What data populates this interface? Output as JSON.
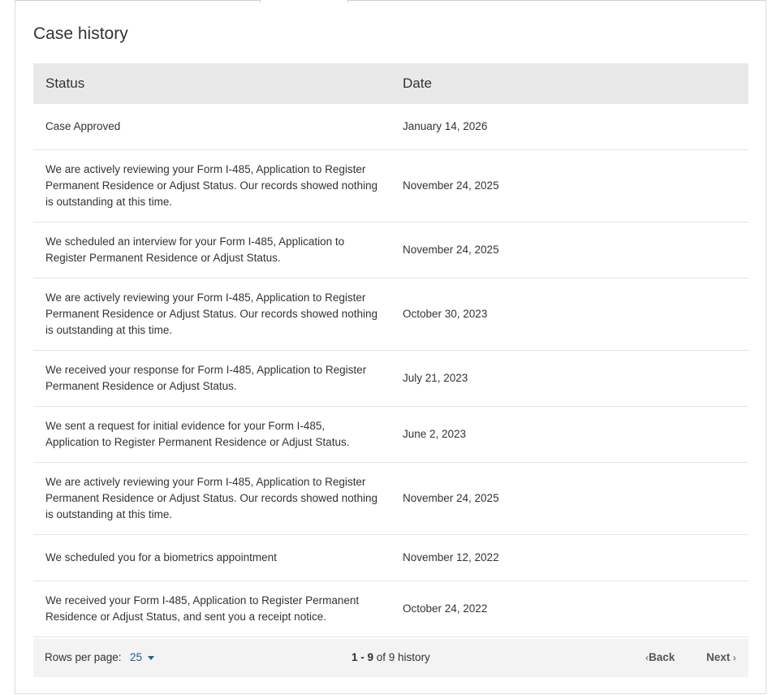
{
  "title": "Case history",
  "table": {
    "headers": {
      "status": "Status",
      "date": "Date"
    },
    "rows": [
      {
        "status": "Case Approved",
        "date": "January 14, 2026"
      },
      {
        "status": "We are actively reviewing your Form I-485, Application to Register Permanent Residence or Adjust Status. Our records showed nothing is outstanding at this time.",
        "date": "November 24, 2025"
      },
      {
        "status": "We scheduled an interview for your Form I-485, Application to Register Permanent Residence or Adjust Status.",
        "date": "November 24, 2025"
      },
      {
        "status": "We are actively reviewing your Form I-485, Application to Register Permanent Residence or Adjust Status. Our records showed nothing is outstanding at this time.",
        "date": "October 30, 2023"
      },
      {
        "status": "We received your response for Form I-485, Application to Register Permanent Residence or Adjust Status.",
        "date": "July 21, 2023"
      },
      {
        "status": "We sent a request for initial evidence for your Form I-485, Application to Register Permanent Residence or Adjust Status.",
        "date": "June 2, 2023"
      },
      {
        "status": "We are actively reviewing your Form I-485, Application to Register Permanent Residence or Adjust Status. Our records showed nothing is outstanding at this time.",
        "date": "November 24, 2025"
      },
      {
        "status": "We scheduled you for a biometrics appointment",
        "date": "November 12, 2022"
      },
      {
        "status": "We received your Form I-485, Application to Register Permanent Residence or Adjust Status, and sent you a receipt notice.",
        "date": "October 24, 2022"
      }
    ]
  },
  "pagination": {
    "rows_per_page_label": "Rows per page:",
    "rows_per_page_value": "25",
    "range_start": "1",
    "range_sep": " - ",
    "range_end": "9",
    "range_of": " of 9 history",
    "back_label": "Back",
    "next_label": "Next",
    "back_icon": "chevron-left-icon",
    "next_icon": "chevron-right-icon",
    "dropdown_icon": "caret-down-icon"
  },
  "colors": {
    "header_bg": "#e9e9e9",
    "footer_bg": "#f3f3f3",
    "link": "#1f5d99",
    "border": "#e4e4e4"
  }
}
